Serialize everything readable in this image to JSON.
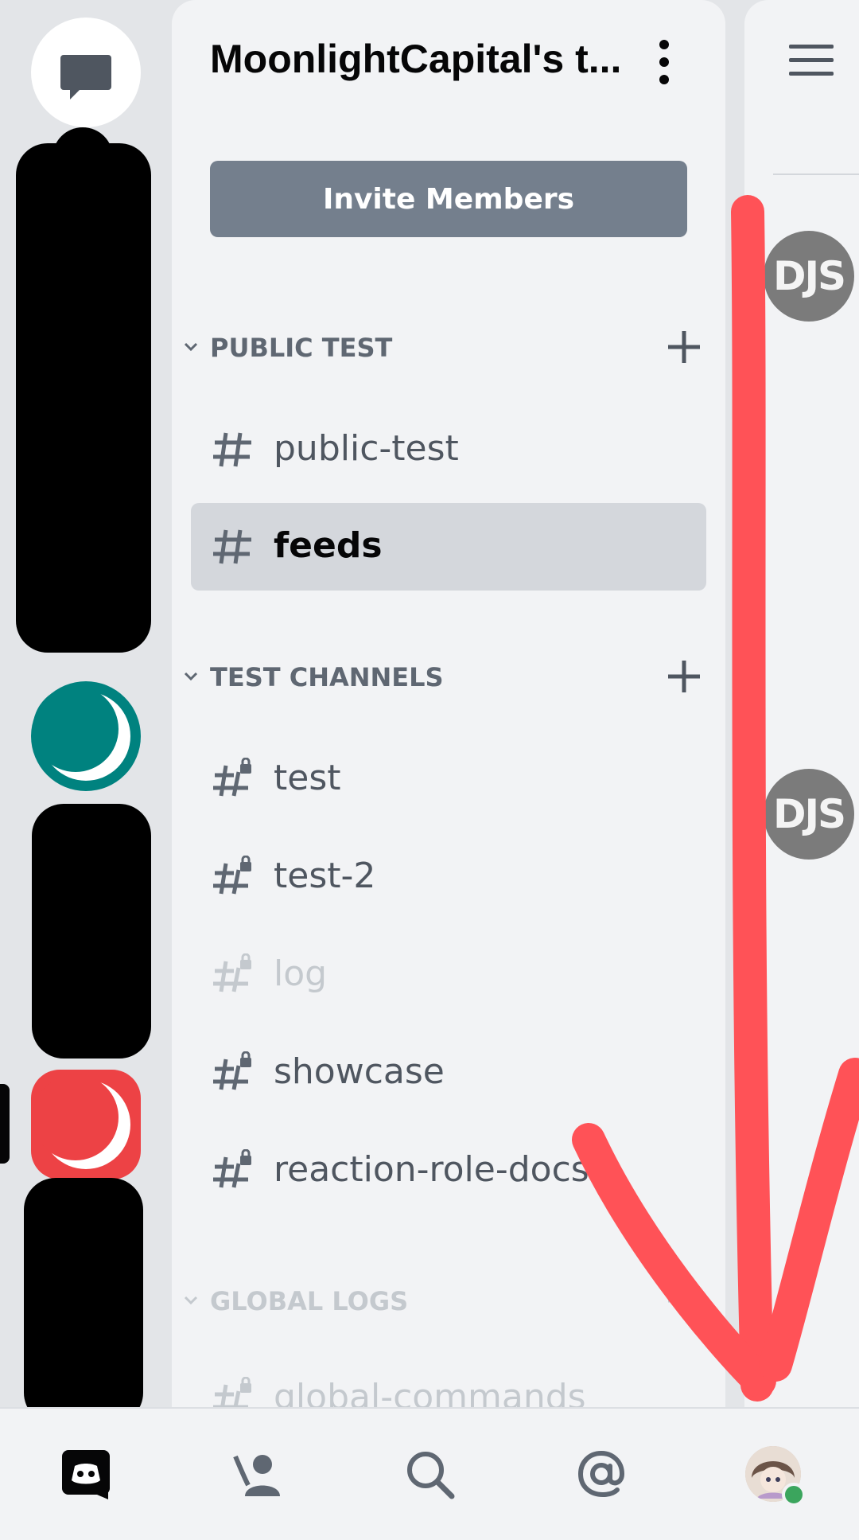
{
  "server": {
    "name": "MoonlightCapital's t..."
  },
  "invite_label": "Invite Members",
  "categories": [
    {
      "name": "PUBLIC TEST",
      "channels": [
        {
          "name": "public-test",
          "locked": false,
          "selected": false
        },
        {
          "name": "feeds",
          "locked": false,
          "selected": true
        }
      ]
    },
    {
      "name": "TEST CHANNELS",
      "channels": [
        {
          "name": "test",
          "locked": true
        },
        {
          "name": "test-2",
          "locked": true
        },
        {
          "name": "log",
          "locked": true,
          "muted": true
        },
        {
          "name": "showcase",
          "locked": true
        },
        {
          "name": "reaction-role-docs",
          "locked": true
        }
      ]
    },
    {
      "name": "GLOBAL LOGS",
      "muted": true,
      "channels": [
        {
          "name": "global-commands",
          "locked": true,
          "muted": true
        }
      ]
    }
  ],
  "right_panel": {
    "avatar_text": "DJS"
  },
  "bottom_nav": [
    "discord-home",
    "friends",
    "search",
    "mentions",
    "profile"
  ],
  "colors": {
    "annotation": "#ff5257",
    "teal_server": "#00827f",
    "red_server": "#ed4245",
    "invite_button": "#747f8d",
    "online": "#3ba55d"
  }
}
